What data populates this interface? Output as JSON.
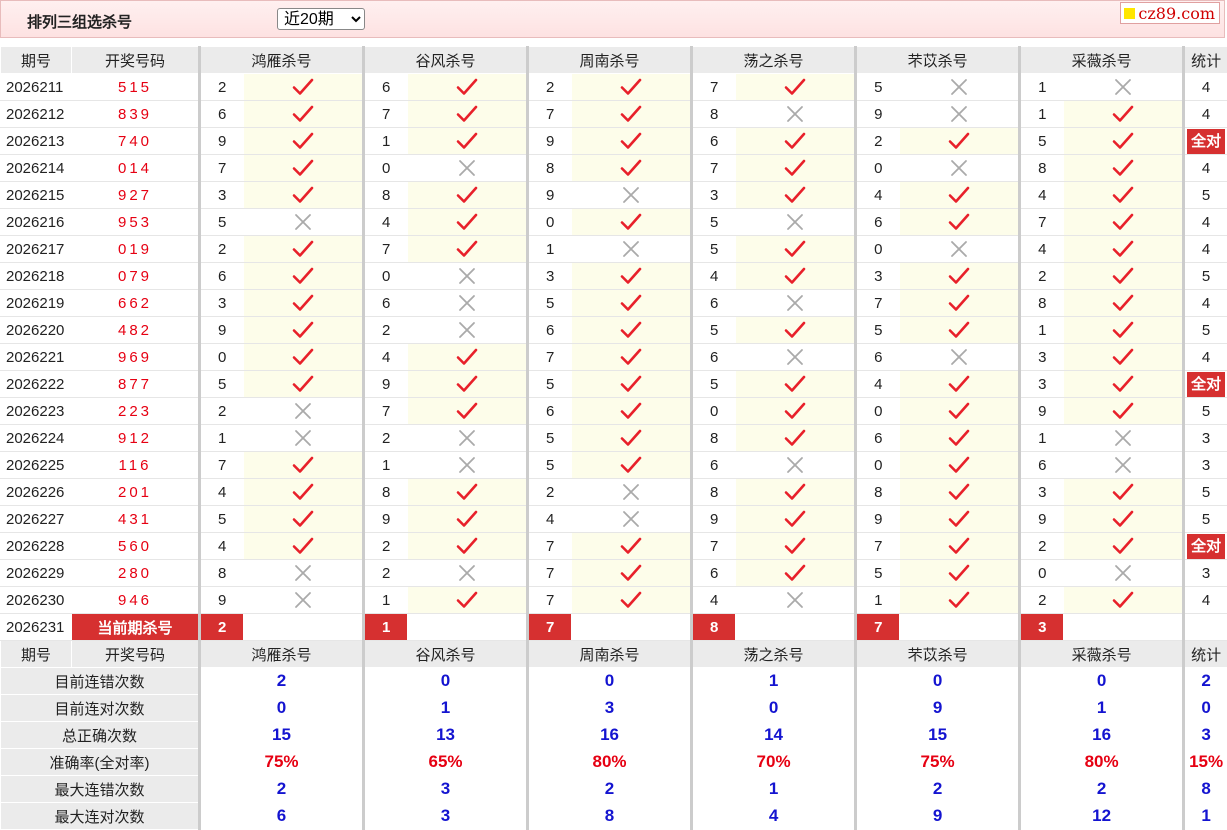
{
  "header": {
    "title": "排列三组选杀号",
    "period_select": {
      "selected": "近20期",
      "options": [
        "近20期"
      ]
    },
    "logo_text": "cz89.com"
  },
  "columns": {
    "period": "期号",
    "draw": "开奖号码",
    "experts": [
      "鸿雁杀号",
      "谷风杀号",
      "周南杀号",
      "荡之杀号",
      "芣苡杀号",
      "采薇杀号"
    ],
    "stat": "统计"
  },
  "rows": [
    {
      "period": "2026211",
      "draw": "515",
      "kills": [
        {
          "n": "2",
          "ok": true
        },
        {
          "n": "6",
          "ok": true
        },
        {
          "n": "2",
          "ok": true
        },
        {
          "n": "7",
          "ok": true
        },
        {
          "n": "5",
          "ok": false
        },
        {
          "n": "1",
          "ok": false
        }
      ],
      "stat": "4"
    },
    {
      "period": "2026212",
      "draw": "839",
      "kills": [
        {
          "n": "6",
          "ok": true
        },
        {
          "n": "7",
          "ok": true
        },
        {
          "n": "7",
          "ok": true
        },
        {
          "n": "8",
          "ok": false
        },
        {
          "n": "9",
          "ok": false
        },
        {
          "n": "1",
          "ok": true
        }
      ],
      "stat": "4"
    },
    {
      "period": "2026213",
      "draw": "740",
      "kills": [
        {
          "n": "9",
          "ok": true
        },
        {
          "n": "1",
          "ok": true
        },
        {
          "n": "9",
          "ok": true
        },
        {
          "n": "6",
          "ok": true
        },
        {
          "n": "2",
          "ok": true
        },
        {
          "n": "5",
          "ok": true
        }
      ],
      "stat": "全对"
    },
    {
      "period": "2026214",
      "draw": "014",
      "kills": [
        {
          "n": "7",
          "ok": true
        },
        {
          "n": "0",
          "ok": false
        },
        {
          "n": "8",
          "ok": true
        },
        {
          "n": "7",
          "ok": true
        },
        {
          "n": "0",
          "ok": false
        },
        {
          "n": "8",
          "ok": true
        }
      ],
      "stat": "4"
    },
    {
      "period": "2026215",
      "draw": "927",
      "kills": [
        {
          "n": "3",
          "ok": true
        },
        {
          "n": "8",
          "ok": true
        },
        {
          "n": "9",
          "ok": false
        },
        {
          "n": "3",
          "ok": true
        },
        {
          "n": "4",
          "ok": true
        },
        {
          "n": "4",
          "ok": true
        }
      ],
      "stat": "5"
    },
    {
      "period": "2026216",
      "draw": "953",
      "kills": [
        {
          "n": "5",
          "ok": false
        },
        {
          "n": "4",
          "ok": true
        },
        {
          "n": "0",
          "ok": true
        },
        {
          "n": "5",
          "ok": false
        },
        {
          "n": "6",
          "ok": true
        },
        {
          "n": "7",
          "ok": true
        }
      ],
      "stat": "4"
    },
    {
      "period": "2026217",
      "draw": "019",
      "kills": [
        {
          "n": "2",
          "ok": true
        },
        {
          "n": "7",
          "ok": true
        },
        {
          "n": "1",
          "ok": false
        },
        {
          "n": "5",
          "ok": true
        },
        {
          "n": "0",
          "ok": false
        },
        {
          "n": "4",
          "ok": true
        }
      ],
      "stat": "4"
    },
    {
      "period": "2026218",
      "draw": "079",
      "kills": [
        {
          "n": "6",
          "ok": true
        },
        {
          "n": "0",
          "ok": false
        },
        {
          "n": "3",
          "ok": true
        },
        {
          "n": "4",
          "ok": true
        },
        {
          "n": "3",
          "ok": true
        },
        {
          "n": "2",
          "ok": true
        }
      ],
      "stat": "5"
    },
    {
      "period": "2026219",
      "draw": "662",
      "kills": [
        {
          "n": "3",
          "ok": true
        },
        {
          "n": "6",
          "ok": false
        },
        {
          "n": "5",
          "ok": true
        },
        {
          "n": "6",
          "ok": false
        },
        {
          "n": "7",
          "ok": true
        },
        {
          "n": "8",
          "ok": true
        }
      ],
      "stat": "4"
    },
    {
      "period": "2026220",
      "draw": "482",
      "kills": [
        {
          "n": "9",
          "ok": true
        },
        {
          "n": "2",
          "ok": false
        },
        {
          "n": "6",
          "ok": true
        },
        {
          "n": "5",
          "ok": true
        },
        {
          "n": "5",
          "ok": true
        },
        {
          "n": "1",
          "ok": true
        }
      ],
      "stat": "5"
    },
    {
      "period": "2026221",
      "draw": "969",
      "kills": [
        {
          "n": "0",
          "ok": true
        },
        {
          "n": "4",
          "ok": true
        },
        {
          "n": "7",
          "ok": true
        },
        {
          "n": "6",
          "ok": false
        },
        {
          "n": "6",
          "ok": false
        },
        {
          "n": "3",
          "ok": true
        }
      ],
      "stat": "4"
    },
    {
      "period": "2026222",
      "draw": "877",
      "kills": [
        {
          "n": "5",
          "ok": true
        },
        {
          "n": "9",
          "ok": true
        },
        {
          "n": "5",
          "ok": true
        },
        {
          "n": "5",
          "ok": true
        },
        {
          "n": "4",
          "ok": true
        },
        {
          "n": "3",
          "ok": true
        }
      ],
      "stat": "全对"
    },
    {
      "period": "2026223",
      "draw": "223",
      "kills": [
        {
          "n": "2",
          "ok": false
        },
        {
          "n": "7",
          "ok": true
        },
        {
          "n": "6",
          "ok": true
        },
        {
          "n": "0",
          "ok": true
        },
        {
          "n": "0",
          "ok": true
        },
        {
          "n": "9",
          "ok": true
        }
      ],
      "stat": "5"
    },
    {
      "period": "2026224",
      "draw": "912",
      "kills": [
        {
          "n": "1",
          "ok": false
        },
        {
          "n": "2",
          "ok": false
        },
        {
          "n": "5",
          "ok": true
        },
        {
          "n": "8",
          "ok": true
        },
        {
          "n": "6",
          "ok": true
        },
        {
          "n": "1",
          "ok": false
        }
      ],
      "stat": "3"
    },
    {
      "period": "2026225",
      "draw": "116",
      "kills": [
        {
          "n": "7",
          "ok": true
        },
        {
          "n": "1",
          "ok": false
        },
        {
          "n": "5",
          "ok": true
        },
        {
          "n": "6",
          "ok": false
        },
        {
          "n": "0",
          "ok": true
        },
        {
          "n": "6",
          "ok": false
        }
      ],
      "stat": "3"
    },
    {
      "period": "2026226",
      "draw": "201",
      "kills": [
        {
          "n": "4",
          "ok": true
        },
        {
          "n": "8",
          "ok": true
        },
        {
          "n": "2",
          "ok": false
        },
        {
          "n": "8",
          "ok": true
        },
        {
          "n": "8",
          "ok": true
        },
        {
          "n": "3",
          "ok": true
        }
      ],
      "stat": "5"
    },
    {
      "period": "2026227",
      "draw": "431",
      "kills": [
        {
          "n": "5",
          "ok": true
        },
        {
          "n": "9",
          "ok": true
        },
        {
          "n": "4",
          "ok": false
        },
        {
          "n": "9",
          "ok": true
        },
        {
          "n": "9",
          "ok": true
        },
        {
          "n": "9",
          "ok": true
        }
      ],
      "stat": "5"
    },
    {
      "period": "2026228",
      "draw": "560",
      "kills": [
        {
          "n": "4",
          "ok": true
        },
        {
          "n": "2",
          "ok": true
        },
        {
          "n": "7",
          "ok": true
        },
        {
          "n": "7",
          "ok": true
        },
        {
          "n": "7",
          "ok": true
        },
        {
          "n": "2",
          "ok": true
        }
      ],
      "stat": "全对"
    },
    {
      "period": "2026229",
      "draw": "280",
      "kills": [
        {
          "n": "8",
          "ok": false
        },
        {
          "n": "2",
          "ok": false
        },
        {
          "n": "7",
          "ok": true
        },
        {
          "n": "6",
          "ok": true
        },
        {
          "n": "5",
          "ok": true
        },
        {
          "n": "0",
          "ok": false
        }
      ],
      "stat": "3"
    },
    {
      "period": "2026230",
      "draw": "946",
      "kills": [
        {
          "n": "9",
          "ok": false
        },
        {
          "n": "1",
          "ok": true
        },
        {
          "n": "7",
          "ok": true
        },
        {
          "n": "4",
          "ok": false
        },
        {
          "n": "1",
          "ok": true
        },
        {
          "n": "2",
          "ok": true
        }
      ],
      "stat": "4"
    }
  ],
  "current": {
    "period": "2026231",
    "label": "当前期杀号",
    "kills": [
      "2",
      "1",
      "7",
      "8",
      "7",
      "3"
    ]
  },
  "summary": [
    {
      "label": "目前连错次数",
      "values": [
        "2",
        "0",
        "0",
        "1",
        "0",
        "0"
      ],
      "stat": "2",
      "red": false
    },
    {
      "label": "目前连对次数",
      "values": [
        "0",
        "1",
        "3",
        "0",
        "9",
        "1"
      ],
      "stat": "0",
      "red": false
    },
    {
      "label": "总正确次数",
      "values": [
        "15",
        "13",
        "16",
        "14",
        "15",
        "16"
      ],
      "stat": "3",
      "red": false
    },
    {
      "label": "准确率(全对率)",
      "values": [
        "75%",
        "65%",
        "80%",
        "70%",
        "75%",
        "80%"
      ],
      "stat": "15%",
      "red": true
    },
    {
      "label": "最大连错次数",
      "values": [
        "2",
        "3",
        "2",
        "1",
        "2",
        "2"
      ],
      "stat": "8",
      "red": false
    },
    {
      "label": "最大连对次数",
      "values": [
        "6",
        "3",
        "8",
        "4",
        "9",
        "12"
      ],
      "stat": "1",
      "red": false
    }
  ],
  "icons": {
    "correct": "check-icon",
    "wrong": "cross-icon",
    "correct_color": "#e8202a",
    "wrong_color": "#aaaaaa",
    "highlight_color": "#d63030"
  }
}
